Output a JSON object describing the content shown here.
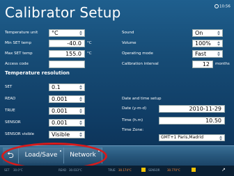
{
  "title": "Calibrator Setup",
  "clock": "10:56",
  "left_settings": [
    {
      "label": "Temperature unit",
      "value": "°C",
      "type": "select"
    },
    {
      "label": "Min SET temp",
      "value": "-40.0",
      "unit": "°C",
      "type": "number"
    },
    {
      "label": "Max SET temp",
      "value": "155.0",
      "unit": "°C",
      "type": "number"
    },
    {
      "label": "Access code",
      "value": "",
      "type": "text"
    }
  ],
  "resolution": {
    "heading": "Temperature resolution",
    "items": [
      {
        "label": "SET",
        "value": "0.1"
      },
      {
        "label": "READ",
        "value": "0.001"
      },
      {
        "label": "TRUE",
        "value": "0.001"
      },
      {
        "label": "SENSOR",
        "value": "0.001"
      },
      {
        "label": "SENSOR visible",
        "value": "Visible"
      }
    ]
  },
  "right_settings": [
    {
      "label": "Sound",
      "value": "On"
    },
    {
      "label": "Volume",
      "value": "100%"
    },
    {
      "label": "Operating mode",
      "value": "Fast"
    }
  ],
  "calibration": {
    "label": "Calibration interval",
    "value": "12",
    "unit": "months"
  },
  "datetime": {
    "heading": "Date and time setup",
    "date_label": "Date (y-m-d)",
    "date_value": "2010-11-29",
    "time_label": "Time (h.m)",
    "time_value": "10.50",
    "tz_label": "Time Zone:",
    "tz_value": "GMT+1 Paris,Madrid"
  },
  "toolbar": {
    "back_symbol": "⮌",
    "load_save": "Load/Save",
    "network": "Network"
  },
  "status": {
    "set_tag": "SET",
    "set_value": "30.0°C",
    "read_tag": "READ",
    "read_value": "30.033°C",
    "true_tag": "TRUE",
    "true_value": "30.174°C",
    "sensor_tag": "SENSOR",
    "sensor_value": "30.770°C"
  },
  "colors": {
    "highlight": "#d81a1a",
    "status_warn": "#f5c400"
  }
}
